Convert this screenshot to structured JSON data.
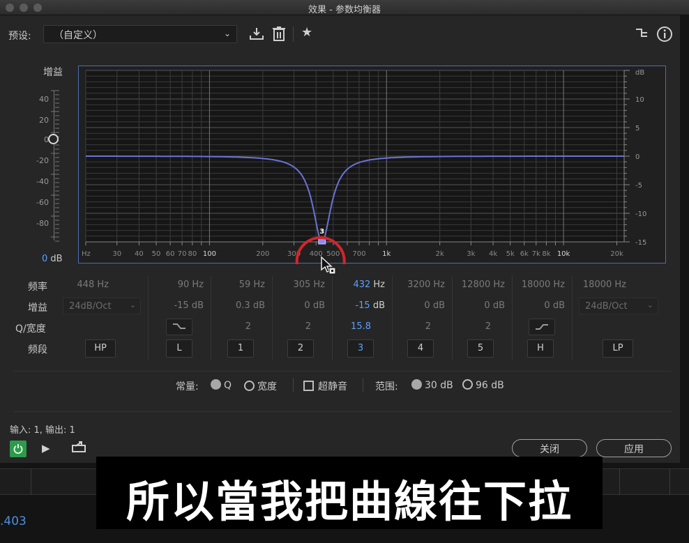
{
  "window": {
    "title": "效果 - 参数均衡器"
  },
  "toolbar": {
    "preset_label": "预设:",
    "preset_value": "（自定义）"
  },
  "gain_slider": {
    "title": "增益",
    "ticks": [
      "40",
      "20",
      "0",
      "-20",
      "-40",
      "-60",
      "-80"
    ],
    "value_num": "0",
    "value_unit": " dB"
  },
  "graph": {
    "right_axis_labels": [
      "dB",
      "10",
      "5",
      "0",
      "-5",
      "-10",
      "-15"
    ],
    "freq_labels": [
      "Hz",
      "30",
      "40",
      "50",
      "60",
      "70",
      "80",
      "100",
      "200",
      "300",
      "400",
      "500",
      "700",
      "1k",
      "2k",
      "3k",
      "4k",
      "5k",
      "6k",
      "7k",
      "8k",
      "10k",
      "20k"
    ],
    "band_marker": "3"
  },
  "bands": {
    "row_labels": {
      "freq": "频率",
      "gain": "增益",
      "q": "Q/宽度",
      "band": "频段"
    },
    "freq": [
      "448 Hz",
      "90 Hz",
      "59 Hz",
      "305 Hz",
      "432",
      "3200 Hz",
      "12800 Hz",
      "18000 Hz",
      "18000 Hz"
    ],
    "active_freq_unit": " Hz",
    "gain": [
      "24dB/Oct",
      "-15 dB",
      "0.3 dB",
      "0 dB",
      "-15",
      "0 dB",
      "0 dB",
      "0 dB",
      "24dB/Oct"
    ],
    "active_gain_unit": " dB",
    "q": [
      "2",
      "2",
      "15.8",
      "2",
      "2"
    ],
    "names": [
      "HP",
      "L",
      "1",
      "2",
      "3",
      "4",
      "5",
      "H",
      "LP"
    ]
  },
  "options": {
    "constant_label": "常量:",
    "q_label": "Q",
    "width_label": "宽度",
    "ultra_quiet_label": "超静音",
    "range_label": "范围:",
    "range_30": "30 dB",
    "range_96": "96 dB"
  },
  "io": {
    "text": "输入: 1, 输出: 1"
  },
  "footer": {
    "close_label": "关闭",
    "apply_label": "应用"
  },
  "timecode": ".403",
  "subtitle": "所以當我把曲線往下拉",
  "colors": {
    "accent_blue": "#5aa0ff",
    "curve": "#6a73d8",
    "power_green": "#2e9a4c",
    "annotation_red": "#d2262b"
  }
}
